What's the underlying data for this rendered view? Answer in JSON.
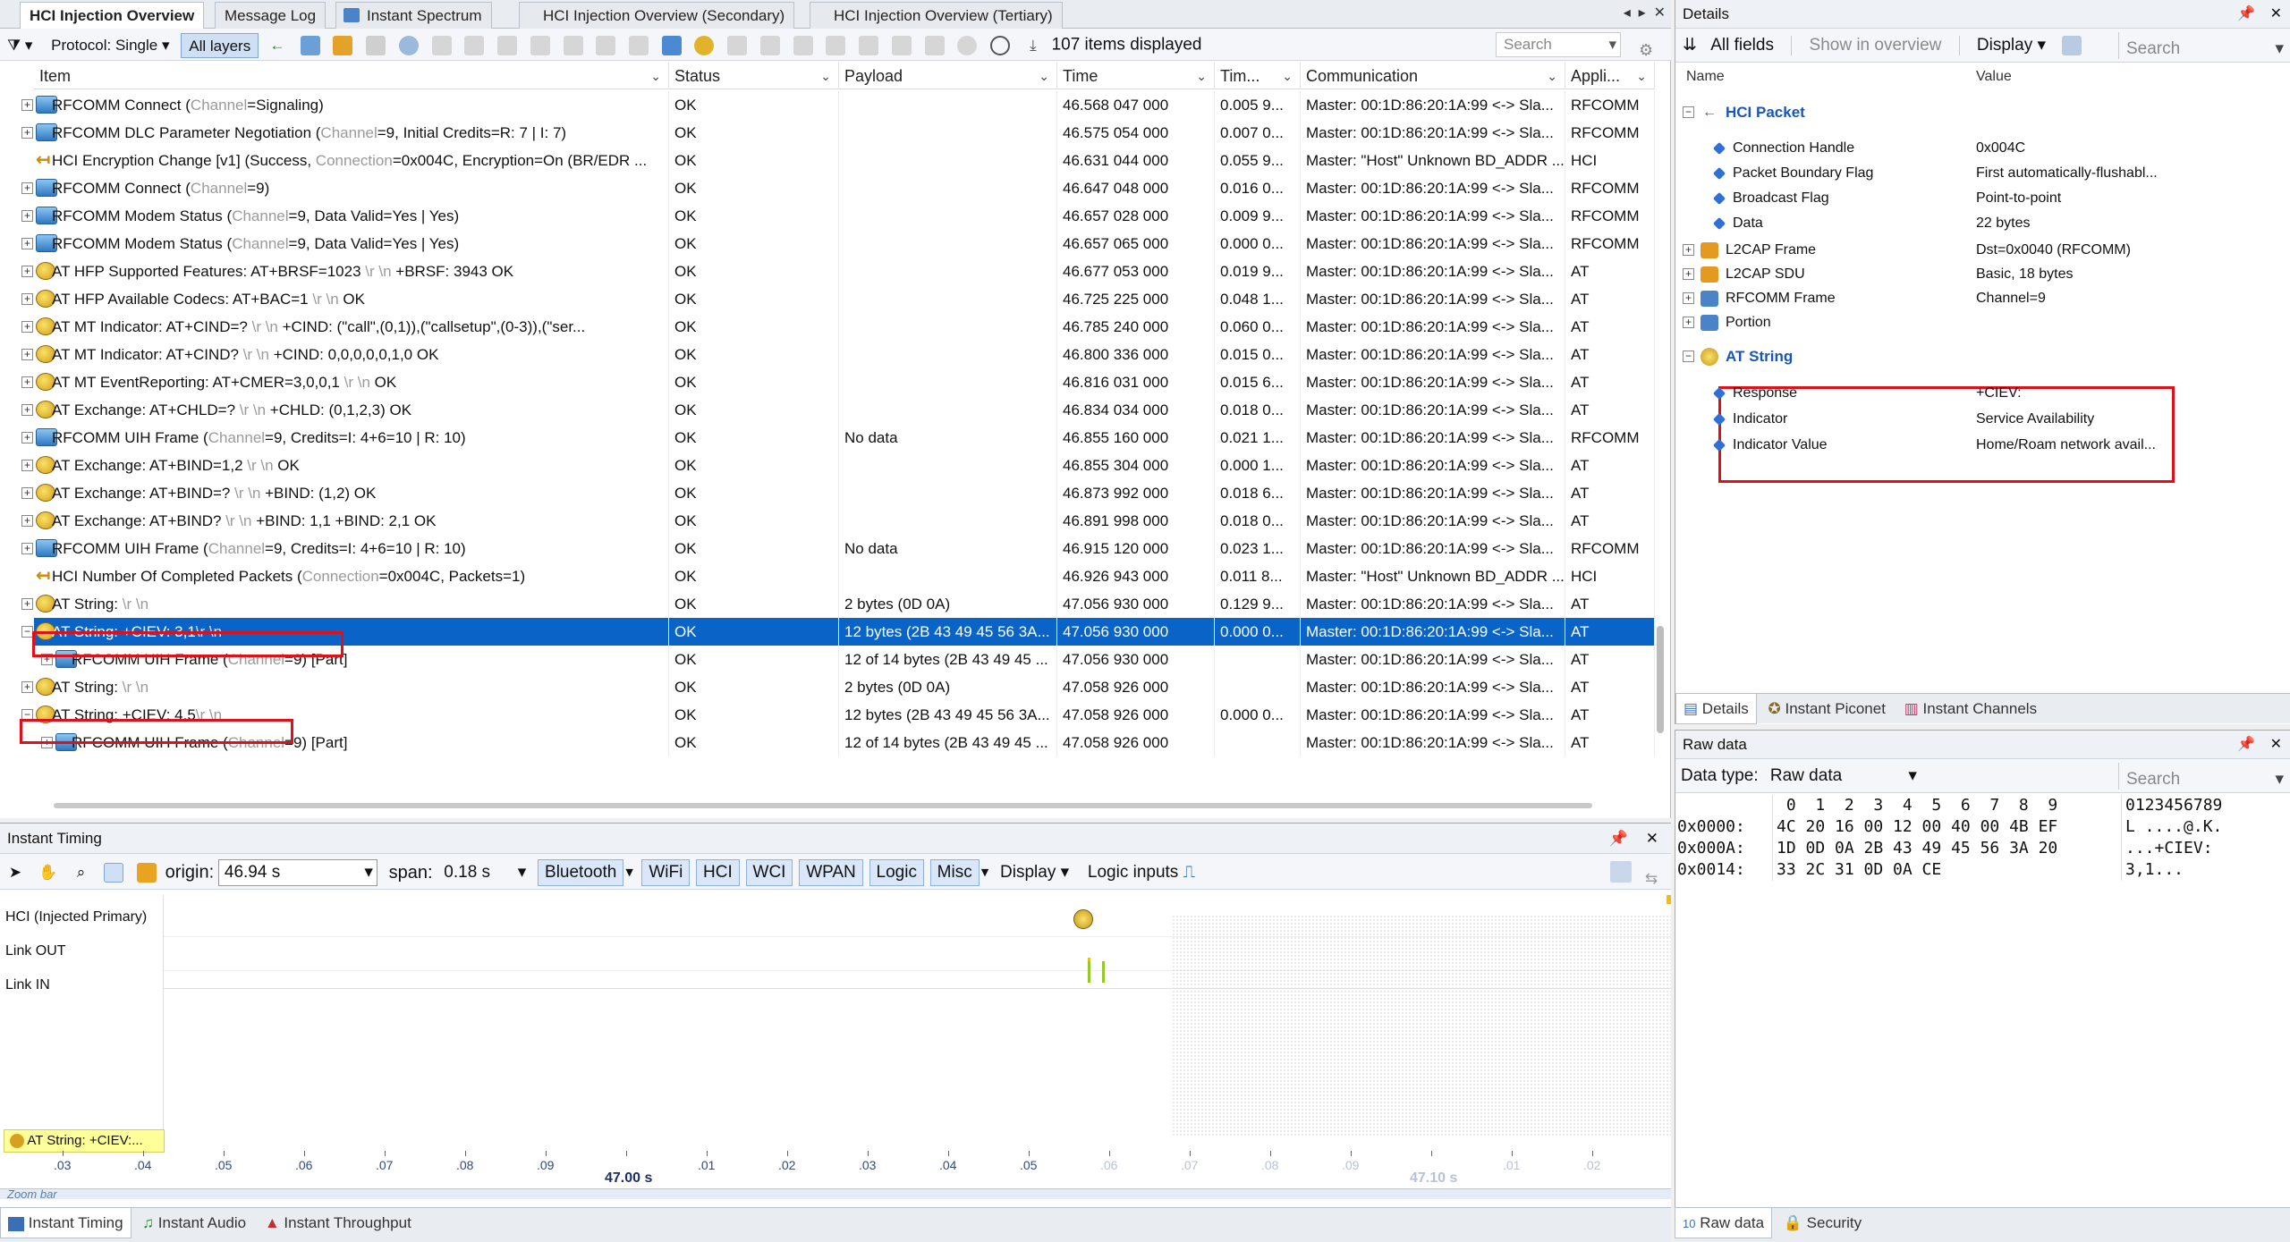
{
  "tabs": [
    "HCI Injection Overview",
    "Message Log",
    "Instant Spectrum",
    "HCI Injection Overview (Secondary)",
    "HCI Injection Overview (Tertiary)"
  ],
  "toolbar": {
    "protocol": "Protocol: Single",
    "layers": "All layers",
    "items_count": "107 items displayed",
    "search_placeholder": "Search"
  },
  "columns": [
    "Item",
    "Status",
    "Payload",
    "Time",
    "Tim...",
    "Communication",
    "Appli..."
  ],
  "rows": [
    {
      "pre": "RFCOMM Connect (",
      "gray": "Channel",
      "post": "=Signaling)",
      "status": "OK",
      "payload": "",
      "time": "46.568 047 000",
      "delta": "0.005 9...",
      "comm": "Master: 00:1D:86:20:1A:99 <-> Sla...",
      "app": "RFCOMM",
      "icon": "rfcomm"
    },
    {
      "pre": "RFCOMM DLC Parameter Negotiation (",
      "gray": "Channel",
      "post": "=9, Initial Credits=R: 7 | I: 7)",
      "status": "OK",
      "payload": "",
      "time": "46.575 054 000",
      "delta": "0.007 0...",
      "comm": "Master: 00:1D:86:20:1A:99 <-> Sla...",
      "app": "RFCOMM",
      "icon": "rfcomm"
    },
    {
      "pre": "HCI Encryption Change [v1] (Success, ",
      "gray": "Connection",
      "post": "=0x004C, Encryption=On (BR/EDR ...",
      "status": "OK",
      "payload": "",
      "time": "46.631 044 000",
      "delta": "0.055 9...",
      "comm": "Master: \"Host\" Unknown BD_ADDR ...",
      "app": "HCI",
      "icon": "hci"
    },
    {
      "pre": "RFCOMM Connect (",
      "gray": "Channel",
      "post": "=9)",
      "status": "OK",
      "payload": "",
      "time": "46.647 048 000",
      "delta": "0.016 0...",
      "comm": "Master: 00:1D:86:20:1A:99 <-> Sla...",
      "app": "RFCOMM",
      "icon": "rfcomm"
    },
    {
      "pre": "RFCOMM Modem Status (",
      "gray": "Channel",
      "post": "=9, Data Valid=Yes | Yes)",
      "status": "OK",
      "payload": "",
      "time": "46.657 028 000",
      "delta": "0.009 9...",
      "comm": "Master: 00:1D:86:20:1A:99 <-> Sla...",
      "app": "RFCOMM",
      "icon": "rfcomm"
    },
    {
      "pre": "RFCOMM Modem Status (",
      "gray": "Channel",
      "post": "=9, Data Valid=Yes | Yes)",
      "status": "OK",
      "payload": "",
      "time": "46.657 065 000",
      "delta": "0.000 0...",
      "comm": "Master: 00:1D:86:20:1A:99 <-> Sla...",
      "app": "RFCOMM",
      "icon": "rfcomm"
    },
    {
      "pre": "AT HFP Supported Features: AT+BRSF=1023",
      "gray": " \\r \\n ",
      "post": " +BRSF: 3943  OK",
      "status": "OK",
      "payload": "",
      "time": "46.677 053 000",
      "delta": "0.019 9...",
      "comm": "Master: 00:1D:86:20:1A:99 <-> Sla...",
      "app": "AT",
      "icon": "at"
    },
    {
      "pre": "AT HFP Available Codecs: AT+BAC=1",
      "gray": " \\r \\n ",
      "post": " OK",
      "status": "OK",
      "payload": "",
      "time": "46.725 225 000",
      "delta": "0.048 1...",
      "comm": "Master: 00:1D:86:20:1A:99 <-> Sla...",
      "app": "AT",
      "icon": "at"
    },
    {
      "pre": "AT MT Indicator: AT+CIND=?",
      "gray": " \\r \\n ",
      "post": " +CIND: (\"call\",(0,1)),(\"callsetup\",(0-3)),(\"ser...",
      "status": "OK",
      "payload": "",
      "time": "46.785 240 000",
      "delta": "0.060 0...",
      "comm": "Master: 00:1D:86:20:1A:99 <-> Sla...",
      "app": "AT",
      "icon": "at"
    },
    {
      "pre": "AT MT Indicator: AT+CIND?",
      "gray": " \\r \\n ",
      "post": " +CIND: 0,0,0,0,0,1,0  OK",
      "status": "OK",
      "payload": "",
      "time": "46.800 336 000",
      "delta": "0.015 0...",
      "comm": "Master: 00:1D:86:20:1A:99 <-> Sla...",
      "app": "AT",
      "icon": "at"
    },
    {
      "pre": "AT MT EventReporting: AT+CMER=3,0,0,1",
      "gray": " \\r \\n ",
      "post": " OK",
      "status": "OK",
      "payload": "",
      "time": "46.816 031 000",
      "delta": "0.015 6...",
      "comm": "Master: 00:1D:86:20:1A:99 <-> Sla...",
      "app": "AT",
      "icon": "at"
    },
    {
      "pre": "AT Exchange: AT+CHLD=?",
      "gray": " \\r \\n ",
      "post": " +CHLD: (0,1,2,3)  OK",
      "status": "OK",
      "payload": "",
      "time": "46.834 034 000",
      "delta": "0.018 0...",
      "comm": "Master: 00:1D:86:20:1A:99 <-> Sla...",
      "app": "AT",
      "icon": "at"
    },
    {
      "pre": "RFCOMM UIH Frame (",
      "gray": "Channel",
      "post": "=9, Credits=I: 4+6=10 | R: 10)",
      "status": "OK",
      "payload": "No data",
      "time": "46.855 160 000",
      "delta": "0.021 1...",
      "comm": "Master: 00:1D:86:20:1A:99 <-> Sla...",
      "app": "RFCOMM",
      "icon": "rfcomm"
    },
    {
      "pre": "AT Exchange: AT+BIND=1,2",
      "gray": " \\r \\n ",
      "post": " OK",
      "status": "OK",
      "payload": "",
      "time": "46.855 304 000",
      "delta": "0.000 1...",
      "comm": "Master: 00:1D:86:20:1A:99 <-> Sla...",
      "app": "AT",
      "icon": "at"
    },
    {
      "pre": "AT Exchange: AT+BIND=?",
      "gray": " \\r \\n ",
      "post": " +BIND: (1,2)  OK",
      "status": "OK",
      "payload": "",
      "time": "46.873 992 000",
      "delta": "0.018 6...",
      "comm": "Master: 00:1D:86:20:1A:99 <-> Sla...",
      "app": "AT",
      "icon": "at"
    },
    {
      "pre": "AT Exchange: AT+BIND?",
      "gray": " \\r \\n ",
      "post": " +BIND: 1,1  +BIND: 2,1  OK",
      "status": "OK",
      "payload": "",
      "time": "46.891 998 000",
      "delta": "0.018 0...",
      "comm": "Master: 00:1D:86:20:1A:99 <-> Sla...",
      "app": "AT",
      "icon": "at"
    },
    {
      "pre": "RFCOMM UIH Frame (",
      "gray": "Channel",
      "post": "=9, Credits=I: 4+6=10 | R: 10)",
      "status": "OK",
      "payload": "No data",
      "time": "46.915 120 000",
      "delta": "0.023 1...",
      "comm": "Master: 00:1D:86:20:1A:99 <-> Sla...",
      "app": "RFCOMM",
      "icon": "rfcomm"
    },
    {
      "pre": "HCI Number Of Completed Packets (",
      "gray": "Connection",
      "post": "=0x004C, Packets=1)",
      "status": "OK",
      "payload": "",
      "time": "46.926 943 000",
      "delta": "0.011 8...",
      "comm": "Master: \"Host\" Unknown BD_ADDR ...",
      "app": "HCI",
      "icon": "hci"
    },
    {
      "pre": "AT String: ",
      "gray": "\\r \\n",
      "post": "",
      "status": "OK",
      "payload": "2 bytes (0D 0A)",
      "time": "47.056 930 000",
      "delta": "0.129 9...",
      "comm": "Master: 00:1D:86:20:1A:99 <-> Sla...",
      "app": "AT",
      "icon": "at"
    },
    {
      "pre": "AT String: +CIEV: 3,1",
      "gray": "\\r \\n",
      "post": "",
      "status": "OK",
      "payload": "12 bytes (2B 43 49 45 56 3A...",
      "time": "47.056 930 000",
      "delta": "0.000 0...",
      "comm": "Master: 00:1D:86:20:1A:99 <-> Sla...",
      "app": "AT",
      "icon": "at"
    },
    {
      "pre": "RFCOMM UIH Frame (",
      "gray": "Channel",
      "post": "=9) [Part]",
      "status": "OK",
      "payload": "12 of 14 bytes (2B 43 49 45 ...",
      "time": "47.056 930 000",
      "delta": "",
      "comm": "Master: 00:1D:86:20:1A:99 <-> Sla...",
      "app": "AT",
      "icon": "rfcomm"
    },
    {
      "pre": "AT String: ",
      "gray": "\\r \\n",
      "post": "",
      "status": "OK",
      "payload": "2 bytes (0D 0A)",
      "time": "47.058 926 000",
      "delta": "",
      "comm": "Master: 00:1D:86:20:1A:99 <-> Sla...",
      "app": "AT",
      "icon": "at"
    },
    {
      "pre": "AT String: +CIEV: 4,5",
      "gray": "\\r \\n",
      "post": "",
      "status": "OK",
      "payload": "12 bytes (2B 43 49 45 56 3A...",
      "time": "47.058 926 000",
      "delta": "0.000 0...",
      "comm": "Master: 00:1D:86:20:1A:99 <-> Sla...",
      "app": "AT",
      "icon": "at"
    },
    {
      "pre": "RFCOMM UIH Frame (",
      "gray": "Channel",
      "post": "=9) [Part]",
      "status": "OK",
      "payload": "12 of 14 bytes (2B 43 49 45 ...",
      "time": "47.058 926 000",
      "delta": "",
      "comm": "Master: 00:1D:86:20:1A:99 <-> Sla...",
      "app": "AT",
      "icon": "rfcomm"
    }
  ],
  "timing": {
    "title": "Instant Timing",
    "origin_label": "origin:",
    "origin_value": "46.94 s",
    "span_label": "span:",
    "span_value": "0.18 s",
    "filters": [
      "Bluetooth",
      "WiFi",
      "HCI",
      "WCI",
      "WPAN",
      "Logic",
      "Misc"
    ],
    "display": "Display",
    "logic_inputs": "Logic inputs",
    "lanes": [
      "HCI (Injected Primary)",
      "Link OUT",
      "Link IN"
    ],
    "annotation": "AT String: +CIEV:...",
    "ticks": [
      ".03",
      ".04",
      ".05",
      ".06",
      ".07",
      ".08",
      ".09",
      "47.00 s",
      ".01",
      ".02",
      ".03",
      ".04",
      ".05",
      ".06",
      ".07",
      ".08",
      ".09",
      "47.10 s",
      ".01",
      ".02"
    ],
    "zoombar": "Zoom bar"
  },
  "bottom_tabs": [
    "Instant Timing",
    "Instant Audio",
    "Instant Throughput"
  ],
  "details": {
    "title": "Details",
    "all_fields": "All fields",
    "show_in_overview": "Show in overview",
    "display": "Display",
    "search": "Search",
    "col_name": "Name",
    "col_value": "Value",
    "hci_packet": "HCI Packet",
    "fields": [
      {
        "name": "Connection Handle",
        "value": "0x004C"
      },
      {
        "name": "Packet Boundary Flag",
        "value": "First automatically-flushabl..."
      },
      {
        "name": "Broadcast Flag",
        "value": "Point-to-point"
      },
      {
        "name": "Data",
        "value": "22 bytes"
      }
    ],
    "groups": [
      {
        "name": "L2CAP Frame",
        "value": "Dst=0x0040 (RFCOMM)"
      },
      {
        "name": "L2CAP SDU",
        "value": "Basic, 18 bytes"
      },
      {
        "name": "RFCOMM Frame",
        "value": "Channel=9"
      },
      {
        "name": "Portion",
        "value": ""
      }
    ],
    "at_string": "AT String",
    "at_fields": [
      {
        "name": "Response",
        "value": "+CIEV:"
      },
      {
        "name": "Indicator",
        "value": "Service Availability"
      },
      {
        "name": "Indicator Value",
        "value": "Home/Roam network avail..."
      }
    ],
    "tabs": [
      "Details",
      "Instant Piconet",
      "Instant Channels"
    ]
  },
  "raw": {
    "title": "Raw data",
    "data_type_label": "Data type:",
    "data_type_value": "Raw data",
    "search": "Search",
    "header": " 0  1  2  3  4  5  6  7  8  9",
    "ascii_header": "0123456789",
    "offsets": [
      "0x0000:",
      "0x000A:",
      "0x0014:"
    ],
    "hex": [
      "4C 20 16 00 12 00 40 00 4B EF",
      "1D 0D 0A 2B 43 49 45 56 3A 20",
      "33 2C 31 0D 0A CE"
    ],
    "ascii": [
      "L ....@.K.",
      "...+CIEV: ",
      "3,1..."
    ],
    "tabs": [
      "Raw data",
      "Security"
    ]
  },
  "colors": {
    "selection": "#0a64c8",
    "highlight_box": "#e0101a",
    "accent": "#1a56b8"
  }
}
